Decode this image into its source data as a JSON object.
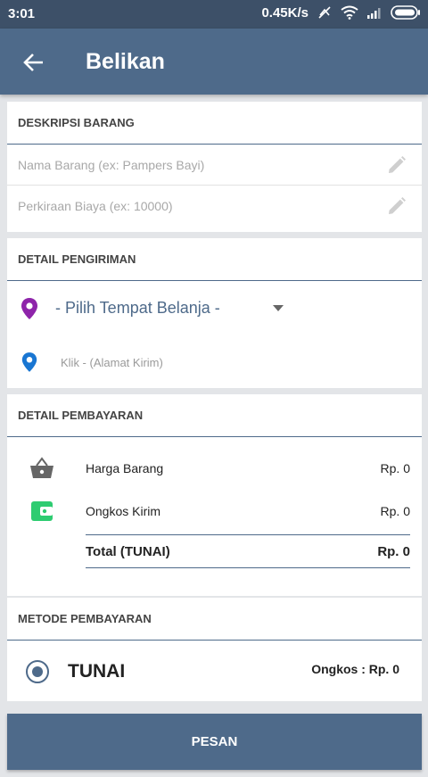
{
  "status_bar": {
    "time": "3:01",
    "speed": "0.45K/s",
    "icons": [
      "data-sync-off-icon",
      "wifi-icon",
      "signal-icon",
      "battery-icon"
    ]
  },
  "app_bar": {
    "title": "Belikan",
    "back_icon": "arrow-left-icon"
  },
  "deskripsi": {
    "title": "DESKRIPSI BARANG",
    "nama_placeholder": "Nama Barang (ex: Pampers Bayi)",
    "nama_value": "",
    "biaya_placeholder": "Perkiraan Biaya (ex: 10000)",
    "biaya_value": "",
    "edit_icon": "pencil-icon"
  },
  "pengiriman": {
    "title": "DETAIL PENGIRIMAN",
    "tempat_label": "- Pilih Tempat Belanja -",
    "alamat_label": "Klik - (Alamat Kirim)",
    "tempat_pin_color": "#8e24aa",
    "alamat_pin_color": "#1976d2"
  },
  "pembayaran": {
    "title": "DETAIL PEMBAYARAN",
    "harga_label": "Harga Barang",
    "harga_value": "Rp. 0",
    "ongkos_label": "Ongkos Kirim",
    "ongkos_value": "Rp. 0",
    "total_label": "Total (TUNAI)",
    "total_value": "Rp. 0",
    "wallet_color": "#2ecc71"
  },
  "metode": {
    "title": "METODE PEMBAYARAN",
    "option_label": "TUNAI",
    "ongkos_text": "Ongkos : Rp. 0",
    "selected": true
  },
  "actions": {
    "pesan_label": "PESAN"
  },
  "colors": {
    "primary": "#4e6a8a",
    "status_bar": "#3d5068",
    "background": "#e3e5e8"
  }
}
